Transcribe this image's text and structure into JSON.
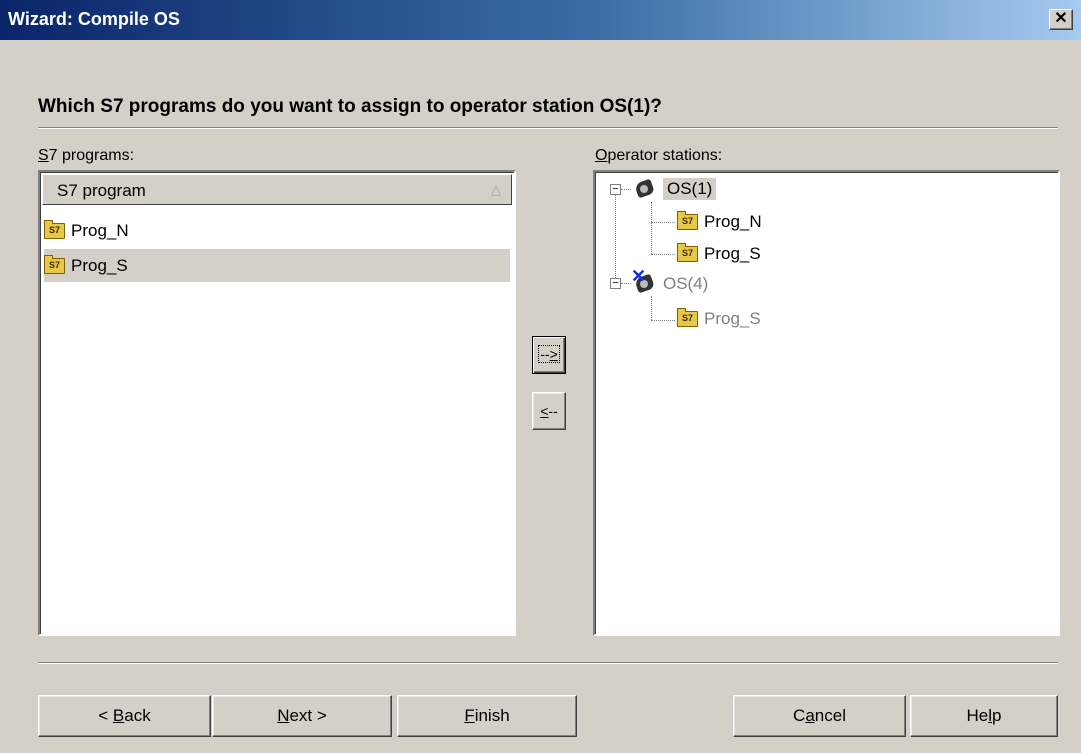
{
  "window": {
    "title": "Wizard: Compile OS",
    "close_glyph": "✕"
  },
  "question": "Which S7 programs do you want to assign to operator station OS(1)?",
  "left_panel": {
    "label_first": "S",
    "label_rest": "7 programs:",
    "column_header": "S7 program",
    "sort_indicator": "△",
    "items": [
      {
        "label": "Prog_N",
        "icon": "s7-folder-icon"
      },
      {
        "label": "Prog_S",
        "icon": "s7-folder-icon",
        "selected": true
      }
    ]
  },
  "right_panel": {
    "label_first": "O",
    "label_rest": "perator stations:",
    "tree": [
      {
        "label": "OS(1)",
        "icon": "operator-station-icon",
        "expanded": true,
        "selected": true,
        "children": [
          {
            "label": "Prog_N"
          },
          {
            "label": "Prog_S"
          }
        ]
      },
      {
        "label": "OS(4)",
        "icon": "operator-station-disabled-icon",
        "expanded": true,
        "disabled": true,
        "children": [
          {
            "label": "Prog_S"
          }
        ]
      }
    ]
  },
  "transfer_buttons": {
    "add_a": "-",
    "add_b": "-",
    "add_c": ">",
    "remove_a": "<",
    "remove_b": "--"
  },
  "buttons": {
    "back_pre": "< ",
    "back_u": "B",
    "back_post": "ack",
    "next_u": "N",
    "next_post": "ext >",
    "finish_u": "F",
    "finish_post": "inish",
    "cancel_pre": "C",
    "cancel_u": "a",
    "cancel_post": "ncel",
    "help_pre": "He",
    "help_u": "l",
    "help_post": "p"
  },
  "colors": {
    "dialog_bg": "#d4d0c8",
    "title_gradient_start": "#0a246a",
    "title_gradient_end": "#a6caf0",
    "disabled_text": "#808080",
    "disabled_mark": "#1030e0"
  }
}
